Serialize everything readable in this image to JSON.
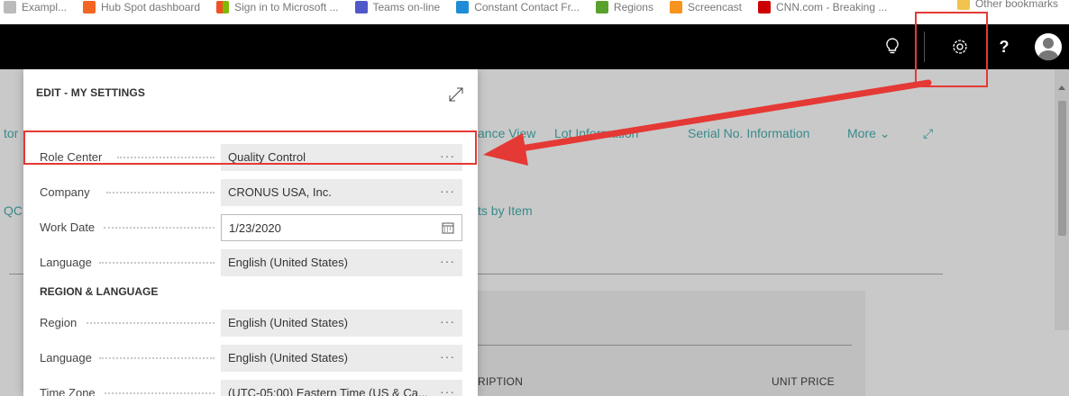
{
  "bookmarks": {
    "items": [
      {
        "label": "Exampl...",
        "color": "#bbbbbb"
      },
      {
        "label": "Hub Spot dashboard",
        "color": "#f26522"
      },
      {
        "label": "Sign in to Microsoft ...",
        "color": "#f25022"
      },
      {
        "label": "Teams on-line",
        "color": "#5059c9"
      },
      {
        "label": "Constant Contact Fr...",
        "color": "#1f8dd6"
      },
      {
        "label": "Regions",
        "color": "#5aa02c"
      },
      {
        "label": "Screencast",
        "color": "#f7941d"
      },
      {
        "label": "CNN.com - Breaking ...",
        "color": "#cc0000"
      }
    ],
    "other": "Other bookmarks"
  },
  "appbar": {
    "icons": [
      "lightbulb-icon",
      "gear-icon",
      "help-icon",
      "avatar-icon"
    ],
    "help_label": "?"
  },
  "background_page": {
    "left_tab_top": "tor",
    "left_tab_mid": "QC",
    "nav_items": [
      "ance View",
      "Lot Information",
      "Serial No. Information",
      "More"
    ],
    "sub_link": "ts by Item",
    "columns": {
      "description": "RIPTION",
      "unit_price": "UNIT PRICE"
    }
  },
  "dialog": {
    "title": "EDIT - MY SETTINGS",
    "fields": [
      {
        "label": "Role Center",
        "value": "Quality Control",
        "control": "lookup"
      },
      {
        "label": "Company",
        "value": "CRONUS USA, Inc.",
        "control": "lookup"
      },
      {
        "label": "Work Date",
        "value": "1/23/2020",
        "control": "date"
      },
      {
        "label": "Language",
        "value": "English (United States)",
        "control": "lookup"
      }
    ],
    "section_title": "REGION & LANGUAGE",
    "region_fields": [
      {
        "label": "Region",
        "value": "English (United States)",
        "control": "lookup"
      },
      {
        "label": "Language",
        "value": "English (United States)",
        "control": "lookup"
      },
      {
        "label": "Time Zone",
        "value": "(UTC-05:00) Eastern Time (US & Ca...",
        "control": "lookup"
      }
    ],
    "lookup_glyph": "···"
  },
  "annotation": {
    "color": "#e53935"
  }
}
